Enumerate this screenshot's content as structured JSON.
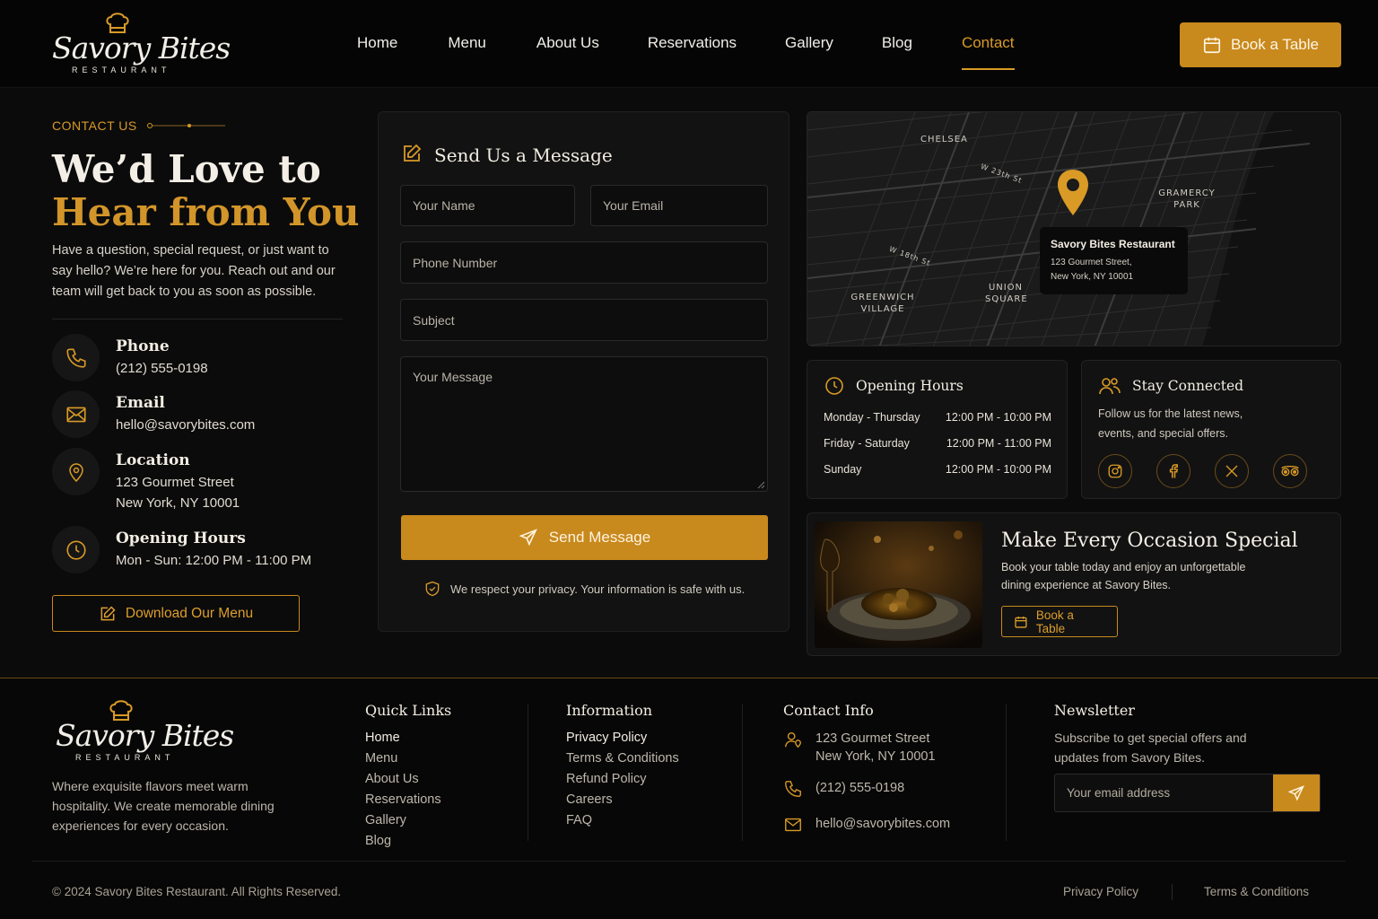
{
  "brand": {
    "name": "Savory Bites",
    "subtitle": "RESTAURANT"
  },
  "nav": {
    "items": [
      "Home",
      "Menu",
      "About Us",
      "Reservations",
      "Gallery",
      "Blog",
      "Contact"
    ],
    "active": "Contact"
  },
  "header": {
    "book_label": "Book a Table"
  },
  "hero": {
    "eyebrow": "CONTACT US",
    "title_line1": "We’d Love to",
    "title_line2": "Hear from You",
    "intro": "Have a question, special request, or just want to say hello? We’re here for you. Reach out and our team will get back to you as soon as possible."
  },
  "contact_items": [
    {
      "icon": "phone-icon",
      "title": "Phone",
      "lines": [
        "(212) 555-0198"
      ]
    },
    {
      "icon": "mail-icon",
      "title": "Email",
      "lines": [
        "hello@savorybites.com"
      ]
    },
    {
      "icon": "location-pin-icon",
      "title": "Location",
      "lines": [
        "123 Gourmet Street",
        "New York, NY 10001"
      ]
    },
    {
      "icon": "clock-icon",
      "title": "Opening Hours",
      "lines": [
        "Mon - Sun: 12:00 PM - 11:00 PM"
      ]
    }
  ],
  "download_menu_label": "Download Our Menu",
  "form": {
    "title": "Send Us a Message",
    "name_placeholder": "Your Name",
    "email_placeholder": "Your Email",
    "phone_placeholder": "Phone Number",
    "subject_placeholder": "Subject",
    "message_placeholder": "Your Message",
    "submit_label": "Send Message",
    "privacy_note": "We respect your privacy. Your information is safe with us."
  },
  "map": {
    "labels": [
      "CHELSEA",
      "GRAMERCY PARK",
      "GREENWICH VILLAGE",
      "UNION SQUARE",
      "W 23th St",
      "W 18th St"
    ],
    "popup_name": "Savory Bites Restaurant",
    "popup_address_1": "123 Gourmet Street,",
    "popup_address_2": "New York, NY 10001"
  },
  "hours_card": {
    "title": "Opening Hours",
    "rows": [
      {
        "day": "Monday - Thursday",
        "time": "12:00 PM - 10:00 PM"
      },
      {
        "day": "Friday - Saturday",
        "time": "12:00 PM - 11:00 PM"
      },
      {
        "day": "Sunday",
        "time": "12:00 PM - 10:00 PM"
      }
    ]
  },
  "social_card": {
    "title": "Stay Connected",
    "text": "Follow us for the latest news, events, and special offers.",
    "icons": [
      "instagram-icon",
      "facebook-icon",
      "x-twitter-icon",
      "tripadvisor-icon"
    ]
  },
  "promo": {
    "title": "Make Every Occasion Special",
    "text": "Book your table today and enjoy an unforgettable dining experience at Savory Bites.",
    "button_label": "Book a Table"
  },
  "footer": {
    "tagline": "Where exquisite flavors meet warm hospitality. We create memorable dining experiences for every occasion.",
    "quick_links_title": "Quick Links",
    "quick_links": [
      "Home",
      "Menu",
      "About Us",
      "Reservations",
      "Gallery",
      "Blog"
    ],
    "info_title": "Information",
    "info_links": [
      "Privacy Policy",
      "Terms & Conditions",
      "Refund Policy",
      "Careers",
      "FAQ"
    ],
    "contact_title": "Contact Info",
    "contact_address_1": "123 Gourmet Street",
    "contact_address_2": "New York, NY 10001",
    "contact_phone": "(212) 555-0198",
    "contact_email": "hello@savorybites.com",
    "newsletter_title": "Newsletter",
    "newsletter_text": "Subscribe to get special offers and updates from Savory Bites.",
    "newsletter_placeholder": "Your email address",
    "copyright": "© 2024 Savory Bites Restaurant. All Rights Reserved.",
    "bottom_links": [
      "Privacy Policy",
      "Terms & Conditions"
    ]
  },
  "colors": {
    "accent": "#c8891d",
    "background": "#0b0b0b",
    "card": "#121212"
  }
}
